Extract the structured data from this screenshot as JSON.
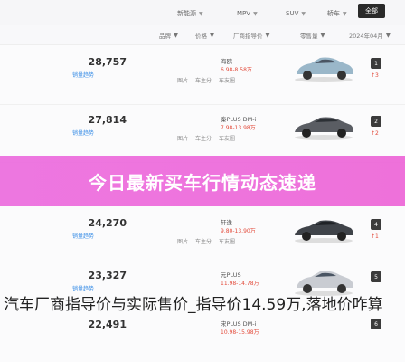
{
  "filters": [
    {
      "label": "新能源"
    },
    {
      "label": "MPV"
    },
    {
      "label": "SUV"
    },
    {
      "label": "轿车"
    }
  ],
  "all_button": "全部",
  "sub_filters": [
    {
      "label": "品牌"
    },
    {
      "label": "价格"
    },
    {
      "label": "厂商指导价"
    },
    {
      "label": "零售量"
    },
    {
      "label": "2024年04月"
    }
  ],
  "rows": [
    {
      "sales": "28,757",
      "sales_label": "销量趋势",
      "name": "海鸥",
      "price": "6.98-8.58万",
      "links": [
        "图片",
        "车主分",
        "车友圈"
      ],
      "car_color": "#9ab7c9",
      "rank": "1",
      "trend": "↑3"
    },
    {
      "sales": "27,814",
      "sales_label": "销量趋势",
      "name": "秦PLUS DM-i",
      "price": "7.98-13.98万",
      "links": [
        "图片",
        "车主分",
        "车友圈"
      ],
      "car_color": "#5a5d63",
      "rank": "2",
      "trend": "↑2"
    },
    {
      "sales": "24,270",
      "sales_label": "销量趋势",
      "name": "轩逸",
      "price": "9.80-13.90万",
      "links": [
        "图片",
        "车主分",
        "车友圈"
      ],
      "car_color": "#3f4349",
      "rank": "4",
      "trend": "↑1"
    },
    {
      "sales": "23,327",
      "sales_label": "销量趋势",
      "name": "元PLUS",
      "price": "11.98-14.78万",
      "links": [
        "图片",
        "车主分",
        "车友圈"
      ],
      "car_color": "#c9ccd2",
      "rank": "5",
      "trend": "↑"
    },
    {
      "sales": "22,491",
      "sales_label": "",
      "name": "宋PLUS DM-i",
      "price": "10.98-15.98万",
      "links": [],
      "car_color": "#d9dde2",
      "rank": "6",
      "trend": ""
    }
  ],
  "banner_title": "今日最新买车行情动态速递",
  "caption": "汽车厂商指导价与实际售价_指导价14.59万,落地价咋算"
}
